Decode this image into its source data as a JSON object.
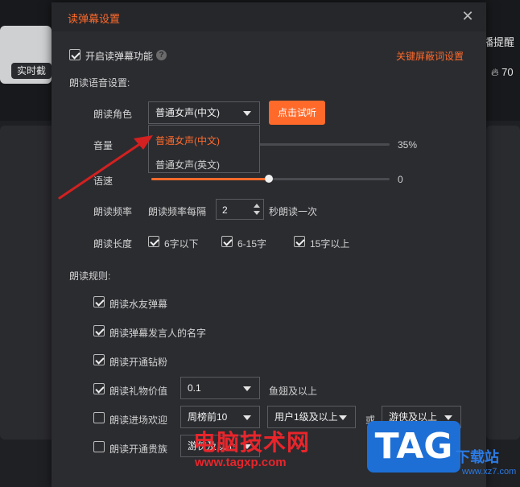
{
  "background": {
    "card_button_label": "实时截",
    "right_text_1": "播提醒",
    "right_count": "70"
  },
  "dialog": {
    "title": "读弹幕设置",
    "enable": {
      "label": "开启读弹幕功能",
      "checked": true
    },
    "keyword_link": "关键屏蔽词设置",
    "voice_section": "朗读语音设置:",
    "role": {
      "label": "朗读角色",
      "selected": "普通女声(中文)",
      "test_button": "点击试听",
      "options": [
        "普通女声(中文)",
        "普通女声(英文)"
      ]
    },
    "volume": {
      "label": "音量",
      "value": "35%",
      "level": 0.35
    },
    "speed": {
      "label": "语速",
      "value": "0",
      "level": 0.5
    },
    "frequency": {
      "label": "朗读频率",
      "prefix": "朗读频率每隔",
      "value": "2",
      "suffix": "秒朗读一次"
    },
    "length": {
      "label": "朗读长度",
      "options": [
        {
          "label": "6字以下",
          "checked": true
        },
        {
          "label": "6-15字",
          "checked": true
        },
        {
          "label": "15字以上",
          "checked": true
        }
      ]
    },
    "rules_section": "朗读规则:",
    "rules": {
      "r1": {
        "label": "朗读水友弹幕",
        "checked": true
      },
      "r2": {
        "label": "朗读弹幕发言人的名字",
        "checked": true
      },
      "r3": {
        "label": "朗读开通钻粉",
        "checked": true
      },
      "r4": {
        "label": "朗读礼物价值",
        "checked": true,
        "select": "0.1",
        "suffix": "鱼翅及以上"
      },
      "r5": {
        "label": "朗读进场欢迎",
        "checked": false,
        "select1": "周榜前10",
        "select2": "用户1级及以上",
        "or": "或",
        "select3": "游侠及以上"
      },
      "r6": {
        "label": "朗读开通贵族",
        "checked": false,
        "select": "游侠及以上"
      }
    }
  },
  "watermark": {
    "site_name": "电脑技术网",
    "site_url": "www.tagxp.com",
    "logo": "TAG",
    "xz": "下载站",
    "xz_url": "www.xz7.com"
  },
  "colors": {
    "accent": "#ff6a2b",
    "dialog_bg": "#2b2c30",
    "arrow": "#d32020"
  }
}
